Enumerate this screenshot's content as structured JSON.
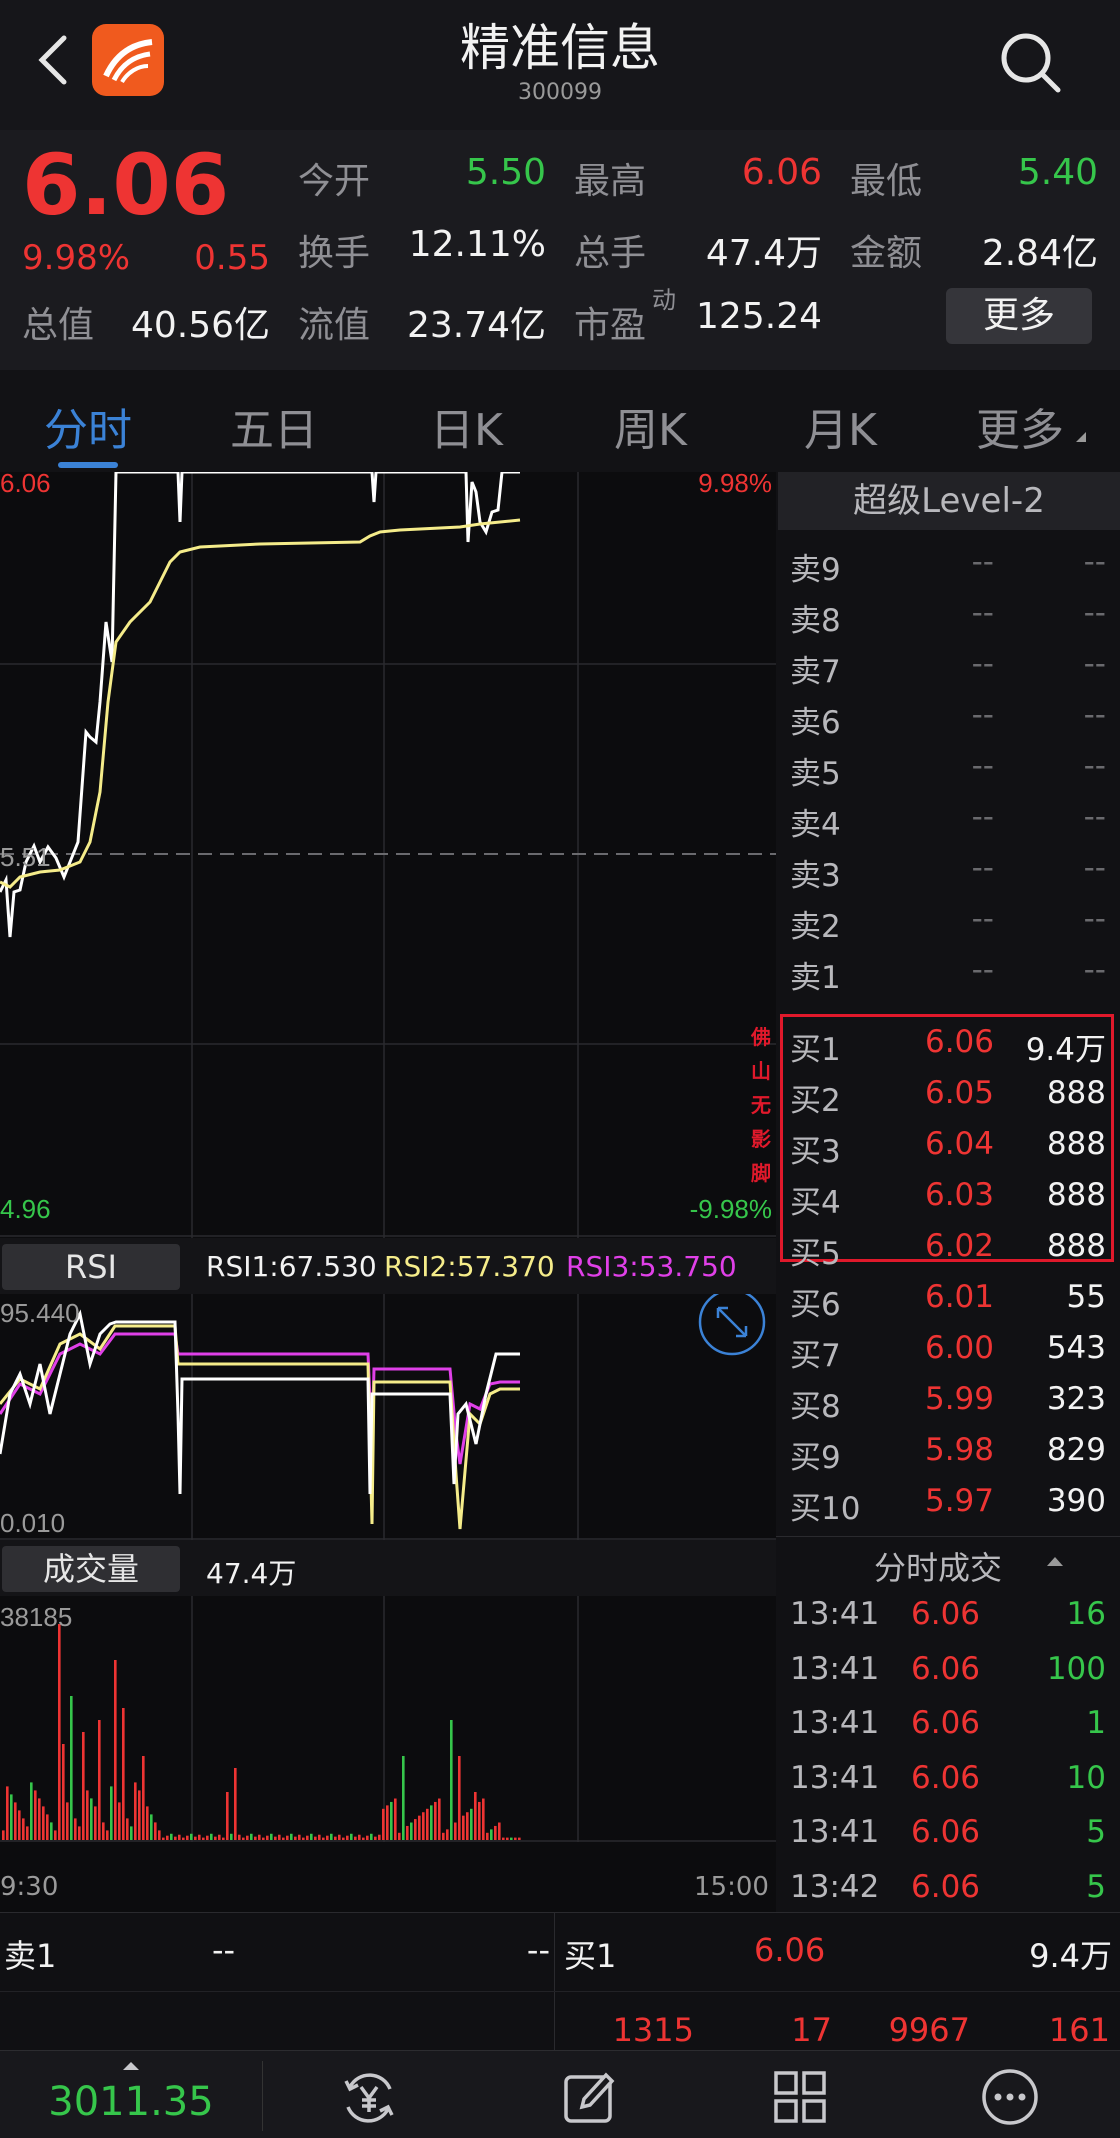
{
  "header": {
    "back_icon": "chevron-left-icon",
    "app_logo_icon": "app-logo-icon",
    "title": "精准信息",
    "code": "300099",
    "search_icon": "search-icon"
  },
  "quote": {
    "price": "6.06",
    "change_pct": "9.98%",
    "change_amt": "0.55",
    "fields": [
      {
        "label": "今开",
        "value": "5.50",
        "color": "#36c64b"
      },
      {
        "label": "最高",
        "value": "6.06",
        "color": "#ee3433"
      },
      {
        "label": "最低",
        "value": "5.40",
        "color": "#36c64b"
      },
      {
        "label": "换手",
        "value": "12.11%",
        "color": "#f2f2f2"
      },
      {
        "label": "总手",
        "value": "47.4万",
        "color": "#f2f2f2"
      },
      {
        "label": "金额",
        "value": "2.84亿",
        "color": "#f2f2f2"
      },
      {
        "label": "总值",
        "value": "40.56亿",
        "color": "#f2f2f2"
      },
      {
        "label": "流值",
        "value": "23.74亿",
        "color": "#f2f2f2"
      },
      {
        "label": "市盈",
        "value": "125.24",
        "color": "#f2f2f2"
      }
    ],
    "pe_superscript": "动",
    "more_button": "更多"
  },
  "tabs": {
    "items": [
      "分时",
      "五日",
      "日K",
      "周K",
      "月K",
      "更多"
    ],
    "active_index": 0,
    "accent": "#3b82d6"
  },
  "price_chart": {
    "high_label": "6.06",
    "mid_label": "5.51",
    "low_label": "4.96",
    "high_pct": "9.98%",
    "low_pct": "-9.98%",
    "watermark": [
      "佛",
      "山",
      "无",
      "影",
      "脚"
    ]
  },
  "rsi": {
    "tab_label": "RSI",
    "rsi1": "RSI1:67.530",
    "rsi2": "RSI2:57.370",
    "rsi3": "RSI3:53.750",
    "max_label": "95.440",
    "min_label": "0.010",
    "expand_icon": "expand-arrows-icon"
  },
  "volume": {
    "tab_label": "成交量",
    "total": "47.4万",
    "max_label": "38185",
    "start_time": "9:30",
    "end_time": "15:00"
  },
  "orderbook": {
    "title": "超级Level-2",
    "asks": [
      {
        "label": "卖9",
        "price": "--",
        "vol": "--"
      },
      {
        "label": "卖8",
        "price": "--",
        "vol": "--"
      },
      {
        "label": "卖7",
        "price": "--",
        "vol": "--"
      },
      {
        "label": "卖6",
        "price": "--",
        "vol": "--"
      },
      {
        "label": "卖5",
        "price": "--",
        "vol": "--"
      },
      {
        "label": "卖4",
        "price": "--",
        "vol": "--"
      },
      {
        "label": "卖3",
        "price": "--",
        "vol": "--"
      },
      {
        "label": "卖2",
        "price": "--",
        "vol": "--"
      },
      {
        "label": "卖1",
        "price": "--",
        "vol": "--"
      }
    ],
    "bids": [
      {
        "label": "买1",
        "price": "6.06",
        "vol": "9.4万"
      },
      {
        "label": "买2",
        "price": "6.05",
        "vol": "888"
      },
      {
        "label": "买3",
        "price": "6.04",
        "vol": "888"
      },
      {
        "label": "买4",
        "price": "6.03",
        "vol": "888"
      },
      {
        "label": "买5",
        "price": "6.02",
        "vol": "888"
      },
      {
        "label": "买6",
        "price": "6.01",
        "vol": "55"
      },
      {
        "label": "买7",
        "price": "6.00",
        "vol": "543"
      },
      {
        "label": "买8",
        "price": "5.99",
        "vol": "323"
      },
      {
        "label": "买9",
        "price": "5.98",
        "vol": "829"
      },
      {
        "label": "买10",
        "price": "5.97",
        "vol": "390"
      }
    ],
    "highlight_color": "#e0192b"
  },
  "trades": {
    "title": "分时成交",
    "rows": [
      {
        "time": "13:41",
        "price": "6.06",
        "vol": "16"
      },
      {
        "time": "13:41",
        "price": "6.06",
        "vol": "100"
      },
      {
        "time": "13:41",
        "price": "6.06",
        "vol": "1"
      },
      {
        "time": "13:41",
        "price": "6.06",
        "vol": "10"
      },
      {
        "time": "13:41",
        "price": "6.06",
        "vol": "5"
      },
      {
        "time": "13:42",
        "price": "6.06",
        "vol": "5"
      }
    ]
  },
  "bottom_book": {
    "sell_label": "卖1",
    "sell_price": "--",
    "sell_vol": "--",
    "buy_label": "买1",
    "buy_price": "6.06",
    "buy_vol": "9.4万",
    "queue": [
      "1315",
      "17",
      "9967",
      "161"
    ]
  },
  "navbar": {
    "index_value": "3011.35",
    "icons": [
      "trade-yuan-icon",
      "edit-icon",
      "grid-icon",
      "more-dots-icon"
    ]
  },
  "colors": {
    "up": "#ee3433",
    "down": "#36c64b",
    "price_line": "#ffffff",
    "avg_line": "#f5ec8a",
    "rsi3_line": "#e040e8"
  }
}
